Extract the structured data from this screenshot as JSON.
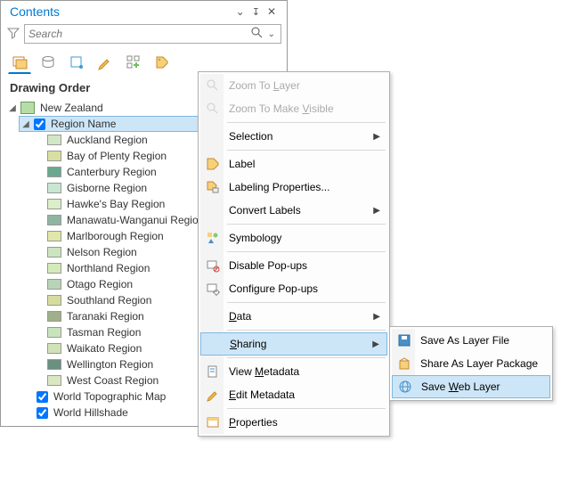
{
  "panel": {
    "title": "Contents",
    "search_placeholder": "Search"
  },
  "section_title": "Drawing Order",
  "map_root": "New Zealand",
  "layer_selected": "Region Name",
  "regions": [
    {
      "label": "Auckland Region",
      "color": "#d2e7c6"
    },
    {
      "label": "Bay of Plenty Region",
      "color": "#d9dfa0"
    },
    {
      "label": "Canterbury Region",
      "color": "#6aa88f"
    },
    {
      "label": "Gisborne Region",
      "color": "#c9e6d3"
    },
    {
      "label": "Hawke's Bay Region",
      "color": "#dbeec7"
    },
    {
      "label": "Manawatu-Wanganui Region",
      "color": "#8eb5a0"
    },
    {
      "label": "Marlborough Region",
      "color": "#e0e7a8"
    },
    {
      "label": "Nelson Region",
      "color": "#cde4c0"
    },
    {
      "label": "Northland Region",
      "color": "#d4ebb9"
    },
    {
      "label": "Otago Region",
      "color": "#b8d4b8"
    },
    {
      "label": "Southland Region",
      "color": "#d6dc9e"
    },
    {
      "label": "Taranaki Region",
      "color": "#9fb08a"
    },
    {
      "label": "Tasman Region",
      "color": "#c8e4bd"
    },
    {
      "label": "Waikato Region",
      "color": "#d0e3b8"
    },
    {
      "label": "Wellington Region",
      "color": "#6a9080"
    },
    {
      "label": "West Coast Region",
      "color": "#d9e8c0"
    }
  ],
  "extra_layers": [
    {
      "label": "World Topographic Map"
    },
    {
      "label": "World Hillshade"
    }
  ],
  "context_menu": [
    {
      "label": "Zoom To Layer",
      "disabled": true,
      "icon": "zoom-layer"
    },
    {
      "label": "Zoom To Make Visible",
      "disabled": true,
      "icon": "zoom-visible"
    },
    {
      "sep": true
    },
    {
      "label": "Selection",
      "submenu": true
    },
    {
      "sep": true
    },
    {
      "label": "Label",
      "icon": "label"
    },
    {
      "label": "Labeling Properties...",
      "icon": "label-props"
    },
    {
      "label": "Convert Labels",
      "submenu": true
    },
    {
      "sep": true
    },
    {
      "label": "Symbology",
      "icon": "symbology"
    },
    {
      "sep": true
    },
    {
      "label": "Disable Pop-ups",
      "icon": "popup-disable"
    },
    {
      "label": "Configure Pop-ups",
      "icon": "popup-config"
    },
    {
      "sep": true
    },
    {
      "label": "Data",
      "submenu": true
    },
    {
      "sep": true
    },
    {
      "label": "Sharing",
      "submenu": true,
      "highlight": true
    },
    {
      "sep": true
    },
    {
      "label": "View Metadata",
      "icon": "metadata-view"
    },
    {
      "label": "Edit Metadata",
      "icon": "metadata-edit"
    },
    {
      "sep": true
    },
    {
      "label": "Properties",
      "icon": "properties"
    }
  ],
  "share_menu": [
    {
      "label": "Save As Layer File",
      "icon": "save-layer"
    },
    {
      "label": "Share As Layer Package",
      "icon": "share-package"
    },
    {
      "label": "Save Web Layer",
      "icon": "save-web",
      "highlight": true
    }
  ],
  "underline": {
    "Zoom To Layer": 8,
    "Zoom To Make Visible": 13,
    "Data": 0,
    "Sharing": 0,
    "View Metadata": 5,
    "Edit Metadata": 0,
    "Properties": 0,
    "Save Web Layer": 5
  }
}
